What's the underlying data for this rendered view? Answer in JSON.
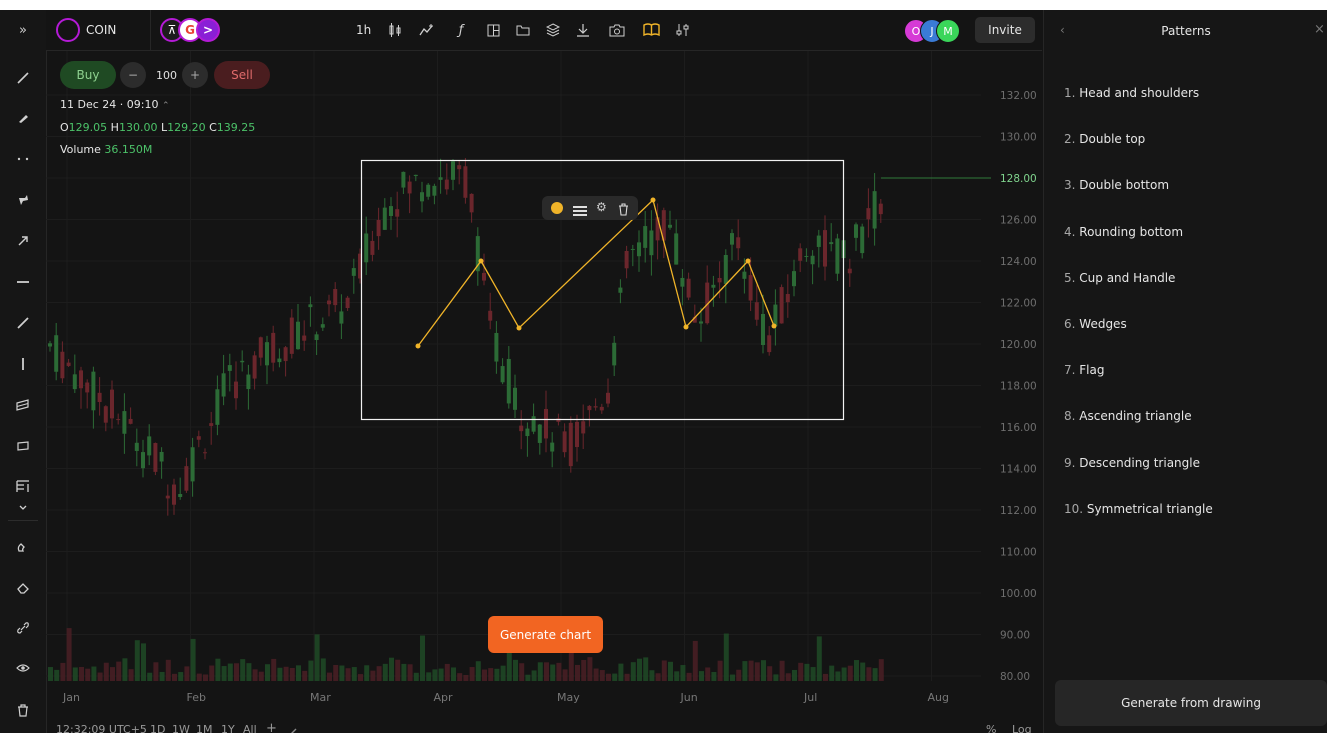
{
  "symbol": {
    "name": "COIN"
  },
  "toolbar": {
    "interval": "1h",
    "invite": "Invite"
  },
  "avatars": [
    {
      "letter": "O",
      "color": "#d63ad6"
    },
    {
      "letter": "J",
      "color": "#3a7bd6"
    },
    {
      "letter": "M",
      "color": "#3ad65a"
    }
  ],
  "trade": {
    "buy": "Buy",
    "sell": "Sell",
    "quantity": "100",
    "minus": "−",
    "plus": "+"
  },
  "info": {
    "datetime": "11 Dec 24 · 09:10",
    "o_label": "O",
    "o": "129.05",
    "h_label": "H",
    "h": "130.00",
    "l_label": "L",
    "l": "129.20",
    "c_label": "C",
    "c": "139.25",
    "volume_label": "Volume",
    "volume": "36.150M"
  },
  "price_axis": [
    "132.00",
    "130.00",
    "128.00",
    "126.00",
    "124.00",
    "122.00",
    "120.00",
    "118.00",
    "116.00",
    "114.00",
    "112.00",
    "110.00",
    "100.00",
    "90.00",
    "80.00"
  ],
  "current_price": "128.00",
  "months": [
    "Jan",
    "Feb",
    "Mar",
    "Apr",
    "May",
    "Jun",
    "Jul",
    "Aug"
  ],
  "bottom": {
    "time": "12:32:09 UTC+5",
    "ranges": [
      "1D",
      "1W",
      "1M",
      "1Y",
      "All"
    ],
    "percent": "%",
    "log": "Log"
  },
  "generate_chart": "Generate chart",
  "panel": {
    "title": "Patterns",
    "items": [
      {
        "num": "1.",
        "label": "Head and shoulders"
      },
      {
        "num": "2.",
        "label": "Double top"
      },
      {
        "num": "3.",
        "label": "Double bottom"
      },
      {
        "num": "4.",
        "label": "Rounding bottom"
      },
      {
        "num": "5.",
        "label": "Cup and Handle"
      },
      {
        "num": "6.",
        "label": "Wedges"
      },
      {
        "num": "7.",
        "label": "Flag"
      },
      {
        "num": "8.",
        "label": "Ascending triangle"
      },
      {
        "num": "9.",
        "label": "Descending triangle"
      },
      {
        "num": "10.",
        "label": "Symmetrical triangle"
      }
    ],
    "generate_button": "Generate from drawing"
  },
  "colors": {
    "up": "#2f7a3a",
    "down": "#7a2a30",
    "drawing": "#f0b429",
    "buy": "#1f4a23",
    "sell": "#4a1d1f",
    "cta": "#f26522"
  },
  "icons": {
    "left_toolbar": [
      "collapse-icon",
      "trend-line-icon",
      "brush-icon",
      "dots-icon",
      "pin-icon",
      "arrow-icon",
      "horizontal-line-icon",
      "ray-icon",
      "vertical-line-icon",
      "channel-icon",
      "rectangle-icon",
      "fib-icon",
      "chevron-down-icon",
      "magnet-icon",
      "eraser-icon",
      "link-icon",
      "eye-icon",
      "trash-icon"
    ],
    "top_toolbar": [
      "candles-icon",
      "indicator-icon",
      "function-icon",
      "layout-icon",
      "folder-icon",
      "layers-icon",
      "download-icon",
      "camera-icon",
      "book-icon",
      "settings-sliders-icon"
    ]
  }
}
